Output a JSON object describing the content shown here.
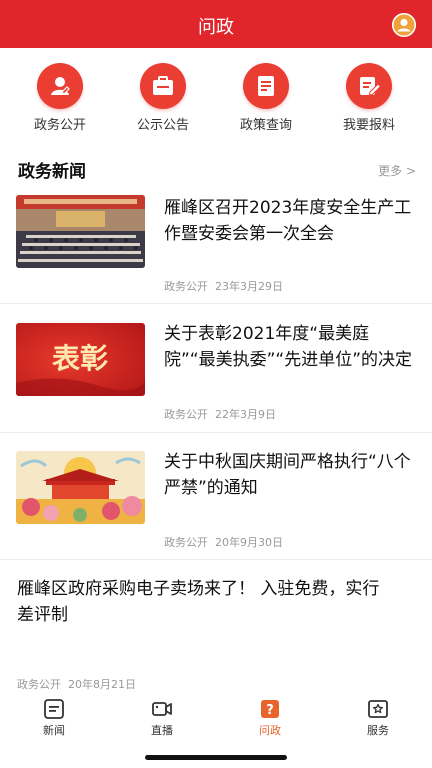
{
  "header": {
    "title": "问政",
    "user_icon": "user-avatar-icon"
  },
  "quick_actions": [
    {
      "label": "政务公开",
      "icon": "person-icon"
    },
    {
      "label": "公示公告",
      "icon": "briefcase-icon"
    },
    {
      "label": "政策查询",
      "icon": "document-icon"
    },
    {
      "label": "我要报料",
      "icon": "edit-icon"
    }
  ],
  "section": {
    "title": "政务新闻",
    "more": "更多 >"
  },
  "news": [
    {
      "title": "雁峰区召开2023年度安全生产工作暨安委会第一次全会",
      "source": "政务公开",
      "date": "23年3月29日"
    },
    {
      "title": "关于表彰2021年度“最美庭院”“最美执委”“先进单位”的决定",
      "source": "政务公开",
      "date": "22年3月9日",
      "thumb_text": "表彰"
    },
    {
      "title": "关于中秋国庆期间严格执行“八个严禁”的通知",
      "source": "政务公开",
      "date": "20年9月30日"
    }
  ],
  "text_news": {
    "title": "雁峰区政府采购电子卖场来了！ 入驻免费，实行差评制",
    "source": "政务公开",
    "date": "20年8月21日"
  },
  "tabs": [
    {
      "label": "新闻",
      "icon": "news-icon",
      "active": false
    },
    {
      "label": "直播",
      "icon": "video-icon",
      "active": false
    },
    {
      "label": "问政",
      "icon": "question-icon",
      "active": true
    },
    {
      "label": "服务",
      "icon": "service-icon",
      "active": false
    }
  ],
  "colors": {
    "brand_red": "#e0262b",
    "icon_red": "#ea3e33",
    "active_tab": "#e9642c",
    "meta_gray": "#999999"
  }
}
